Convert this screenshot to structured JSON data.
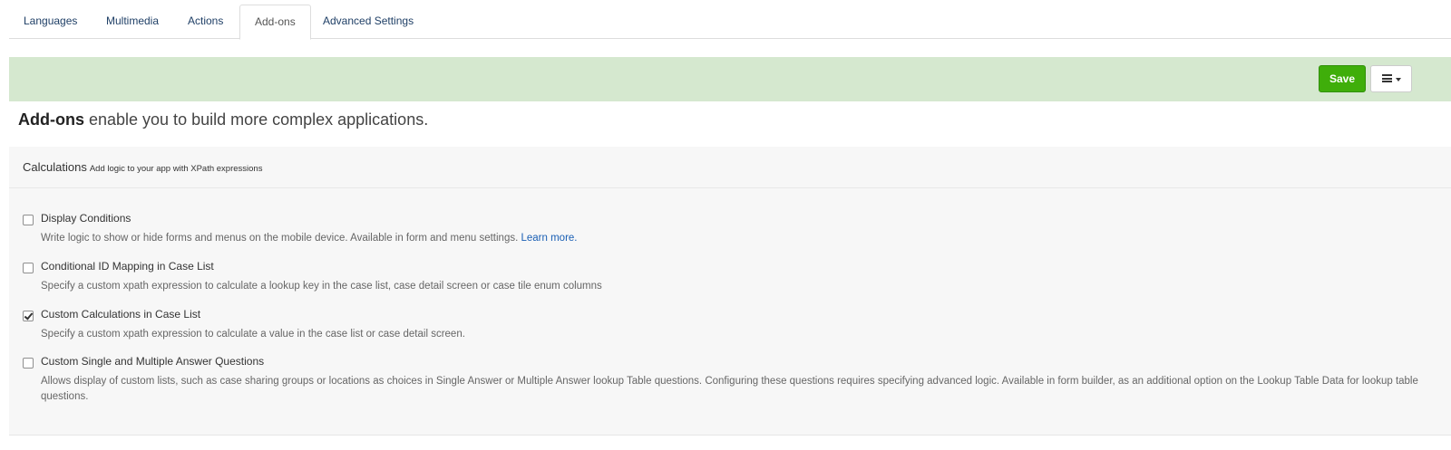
{
  "tabs": [
    {
      "label": "Languages"
    },
    {
      "label": "Multimedia"
    },
    {
      "label": "Actions"
    },
    {
      "label": "Add-ons",
      "active": true
    },
    {
      "label": "Advanced Settings"
    }
  ],
  "toolbar": {
    "save_label": "Save",
    "menu_icon": "hamburger-menu-icon",
    "save_color": "#3fae0a",
    "bar_color": "#d5e8cf"
  },
  "intro": {
    "bold": "Add-ons",
    "text": " enable you to build more complex applications."
  },
  "section": {
    "title": "Calculations",
    "subtitle": "Add logic to your app with XPath expressions",
    "items": [
      {
        "title": "Display Conditions",
        "desc": "Write logic to show or hide forms and menus on the mobile device. Available in form and menu settings.",
        "link": "Learn more.",
        "checked": false
      },
      {
        "title": "Conditional ID Mapping in Case List",
        "desc": "Specify a custom xpath expression to calculate a lookup key in the case list, case detail screen or case tile enum columns",
        "checked": false
      },
      {
        "title": "Custom Calculations in Case List",
        "desc": "Specify a custom xpath expression to calculate a value in the case list or case detail screen.",
        "checked": true
      },
      {
        "title": "Custom Single and Multiple Answer Questions",
        "desc": "Allows display of custom lists, such as case sharing groups or locations as choices in Single Answer or Multiple Answer lookup Table questions. Configuring these questions requires specifying advanced logic. Available in form builder, as an additional option on the Lookup Table Data for lookup table questions.",
        "checked": false
      }
    ]
  }
}
